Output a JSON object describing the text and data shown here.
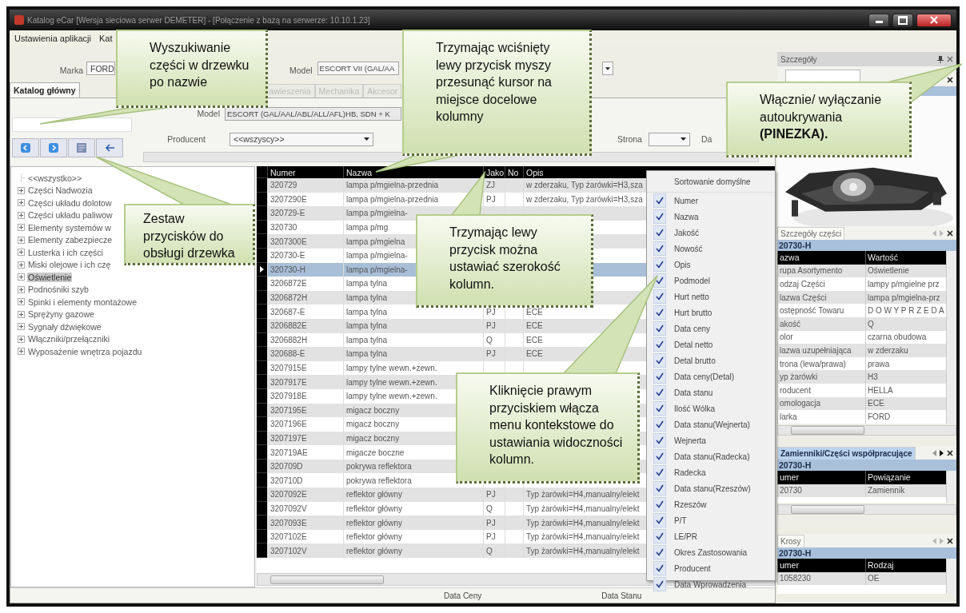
{
  "window": {
    "title": "Katalog eCar [Wersja sieciowa serwer DEMETER]  -  [Połączenie z bazą na serwerze: 10.10.1.23]"
  },
  "menu": [
    "Ustawienia aplikacji",
    "Kat"
  ],
  "vehicle": {
    "make_label": "Marka",
    "make": "FORD",
    "model_label": "Model",
    "model": "ESCORT VII (GAL/AA"
  },
  "tabs": [
    {
      "label": "Katalog główny",
      "selected": true
    },
    {
      "label": "awieszenia",
      "selected": false
    },
    {
      "label": "Mechanika",
      "selected": false
    },
    {
      "label": "Akcesor",
      "selected": false
    }
  ],
  "filters": {
    "model_label": "Model",
    "model": "ESCORT (GAL/AAL/ABL/ALL/AFL)HB, SDN + K",
    "producer_label": "Producent",
    "producer": "<<wszyscy>>",
    "page_label": "Strona",
    "column_4_label": "Da"
  },
  "tree": [
    {
      "label": "<<wszystko>>",
      "kind": "root",
      "selected": false
    },
    {
      "label": "Części Nadwozia",
      "kind": "group",
      "selected": false
    },
    {
      "label": "Części układu dolotow",
      "kind": "group",
      "selected": false
    },
    {
      "label": "Części układu paliwow",
      "kind": "group",
      "selected": false
    },
    {
      "label": "Elementy systemów w",
      "kind": "group",
      "selected": false
    },
    {
      "label": "Elementy zabezpiecze",
      "kind": "group",
      "selected": false
    },
    {
      "label": "Lusterka i ich części",
      "kind": "group",
      "selected": false
    },
    {
      "label": "Miski olejowe i ich czę",
      "kind": "group",
      "selected": false
    },
    {
      "label": "Oświetlenie",
      "kind": "group",
      "selected": true
    },
    {
      "label": "Podnośniki szyb",
      "kind": "group",
      "selected": false
    },
    {
      "label": "Spinki i elementy montażowe",
      "kind": "group",
      "selected": false
    },
    {
      "label": "Sprężyny gazowe",
      "kind": "group",
      "selected": false
    },
    {
      "label": "Sygnały dźwiękowe",
      "kind": "group",
      "selected": false
    },
    {
      "label": "Włączniki/przełączniki",
      "kind": "group",
      "selected": false
    },
    {
      "label": "Wyposażenie wnętrza pojazdu",
      "kind": "group",
      "selected": false
    }
  ],
  "table": {
    "columns": [
      "Numer",
      "Nazwa",
      "Jako",
      "No",
      "Opis"
    ],
    "rows": [
      {
        "numer": "320729",
        "nazwa": "lampa p/mgielna-przednia",
        "jako": "ZJ",
        "opis": "w zderzaku, Typ żarówki=H3,sza",
        "selected": false
      },
      {
        "numer": "3207290E",
        "nazwa": "lampa p/mgielna-przednia",
        "jako": "PJ",
        "opis": "w zderzaku, Typ żarówki=H3,sza",
        "selected": false
      },
      {
        "numer": "320729-E",
        "nazwa": "lampa p/mgielna-",
        "selected": false
      },
      {
        "numer": "320730",
        "nazwa": "lampa p/mg",
        "selected": false
      },
      {
        "numer": "3207300E",
        "nazwa": "lampa p/mgielna",
        "selected": false
      },
      {
        "numer": "320730-E",
        "nazwa": "lampa p/mgielna-",
        "selected": false
      },
      {
        "numer": "320730-H",
        "nazwa": "lampa p/mgielna-",
        "selected": true
      },
      {
        "numer": "3206872E",
        "nazwa": "lampa tylna",
        "selected": false
      },
      {
        "numer": "3206872H",
        "nazwa": "lampa tylna",
        "selected": false
      },
      {
        "numer": "320687-E",
        "nazwa": "lampa tylna",
        "jako": "PJ",
        "opis": "ECE",
        "selected": false
      },
      {
        "numer": "3206882E",
        "nazwa": "lampa tylna",
        "jako": "PJ",
        "opis": "ECE",
        "selected": false
      },
      {
        "numer": "3206882H",
        "nazwa": "lampa tylna",
        "jako": "Q",
        "opis": "ECE",
        "selected": false
      },
      {
        "numer": "320688-E",
        "nazwa": "lampa tylna",
        "jako": "PJ",
        "opis": "ECE",
        "selected": false
      },
      {
        "numer": "3207915E",
        "nazwa": "lampy tylne wewn.+zewn.",
        "selected": false
      },
      {
        "numer": "3207917E",
        "nazwa": "lampy tylne wewn.+zewn.",
        "selected": false
      },
      {
        "numer": "3207918E",
        "nazwa": "lampy tylne wewn.+zewn.",
        "selected": false
      },
      {
        "numer": "3207195E",
        "nazwa": "migacz boczny",
        "selected": false
      },
      {
        "numer": "3207196E",
        "nazwa": "migacz boczny",
        "selected": false
      },
      {
        "numer": "3207197E",
        "nazwa": "migacz boczny",
        "selected": false
      },
      {
        "numer": "320719AE",
        "nazwa": "migacze boczne",
        "selected": false
      },
      {
        "numer": "320709D",
        "nazwa": "pokrywa reflektora",
        "selected": false
      },
      {
        "numer": "320710D",
        "nazwa": "pokrywa reflektora",
        "selected": false
      },
      {
        "numer": "3207092E",
        "nazwa": "reflektor główny",
        "jako": "PJ",
        "opis": "Typ żarówki=H4,manualny/elekt",
        "selected": false
      },
      {
        "numer": "3207092V",
        "nazwa": "reflektor główny",
        "jako": "Q",
        "opis": "Typ żarówki=H4,manualny/elekt",
        "selected": false
      },
      {
        "numer": "3207093E",
        "nazwa": "reflektor główny",
        "jako": "PJ",
        "opis": "Typ żarówki=H4,manualny/elekt",
        "selected": false
      },
      {
        "numer": "3207102E",
        "nazwa": "reflektor główny",
        "jako": "PJ",
        "opis": "Typ żarówki=H4,manualny/elekt",
        "selected": false
      },
      {
        "numer": "3207102V",
        "nazwa": "reflektor główny",
        "jako": "Q",
        "opis": "Typ żarówki=H4,manualny/elekt",
        "selected": false
      }
    ]
  },
  "context_menu": {
    "header": "Sortowanie domyślne",
    "items": [
      {
        "label": "Numer",
        "checked": true
      },
      {
        "label": "Nazwa",
        "checked": true
      },
      {
        "label": "Jakość",
        "checked": true
      },
      {
        "label": "Nowość",
        "checked": true
      },
      {
        "label": "Opis",
        "checked": true
      },
      {
        "label": "Podmodel",
        "checked": true
      },
      {
        "label": "Hurt netto",
        "checked": true
      },
      {
        "label": "Hurt brutto",
        "checked": true
      },
      {
        "label": "Data ceny",
        "checked": true
      },
      {
        "label": "Detal netto",
        "checked": true
      },
      {
        "label": "Detal brutto",
        "checked": true
      },
      {
        "label": "Data ceny(Detal)",
        "checked": true
      },
      {
        "label": "Data stanu",
        "checked": true
      },
      {
        "label": "Ilość Wólka",
        "checked": true
      },
      {
        "label": "Data stanu(Wejnerta)",
        "checked": true
      },
      {
        "label": "Wejnerta",
        "checked": true
      },
      {
        "label": "Data stanu(Radecka)",
        "checked": true
      },
      {
        "label": "Radecka",
        "checked": true
      },
      {
        "label": "Data stanu(Rzeszów)",
        "checked": true
      },
      {
        "label": "Rzeszów",
        "checked": true
      },
      {
        "label": "P/T",
        "checked": true
      },
      {
        "label": "LE/PR",
        "checked": true
      },
      {
        "label": "Okres Zastosowania",
        "checked": true
      },
      {
        "label": "Producent",
        "checked": true
      },
      {
        "label": "Data Wprowadzenia",
        "checked": true
      }
    ]
  },
  "status_bar": [
    "Data Ceny",
    "Data Stanu"
  ],
  "details": {
    "title": "Szczegóły",
    "panels": [
      {
        "tab": "Szczegóły części",
        "selected": false,
        "part": "20730-H",
        "columns": [
          "azwa",
          "Wartość"
        ],
        "rows": [
          [
            "rupa Asortymento",
            "Oświetlenie"
          ],
          [
            "odzaj Części",
            "lampy p/mgielne prz"
          ],
          [
            "lazwa Części",
            "lampa p/mgielna-prz"
          ],
          [
            "ostępność Towaru",
            "D O W Y P R Z E D A"
          ],
          [
            "akość",
            "Q"
          ],
          [
            "olor",
            "czarna obudowa"
          ],
          [
            "lazwa uzupełniająca",
            "w zderzaku"
          ],
          [
            "trona (lewa/prawa)",
            "prawa"
          ],
          [
            "yp żarówki",
            "H3"
          ],
          [
            "roducent",
            "HELLA"
          ],
          [
            "omologacja",
            "ECE"
          ],
          [
            "larka",
            "FORD"
          ]
        ]
      },
      {
        "tab": "Zamienniki/Części współpracujące",
        "selected": true,
        "part": "20730-H",
        "columns": [
          "umer",
          "Powiązanie"
        ],
        "rows": [
          [
            "20730",
            "Zamiennik"
          ]
        ]
      },
      {
        "tab": "Krosy",
        "selected": false,
        "part": "20730-H",
        "columns": [
          "umer",
          "Rodzaj"
        ],
        "rows": [
          [
            "1058230",
            "OE"
          ]
        ]
      }
    ]
  },
  "annotations": [
    "Wyszukiwanie części w drzewku po nazwie",
    "Trzymając wciśnięty lewy przycisk myszy przesunąć kursor na miejsce docelowe kolumny",
    "Włącznie/ wyłączanie autoukrywania **(PINEZKA).**",
    "Zestaw przycisków do obsługi drzewka",
    "Trzymając lewy przycisk można ustawiać szerokość kolumn.",
    "Kliknięcie prawym przyciskiem włącza menu kontekstowe do ustawiania widoczności kolumn."
  ]
}
